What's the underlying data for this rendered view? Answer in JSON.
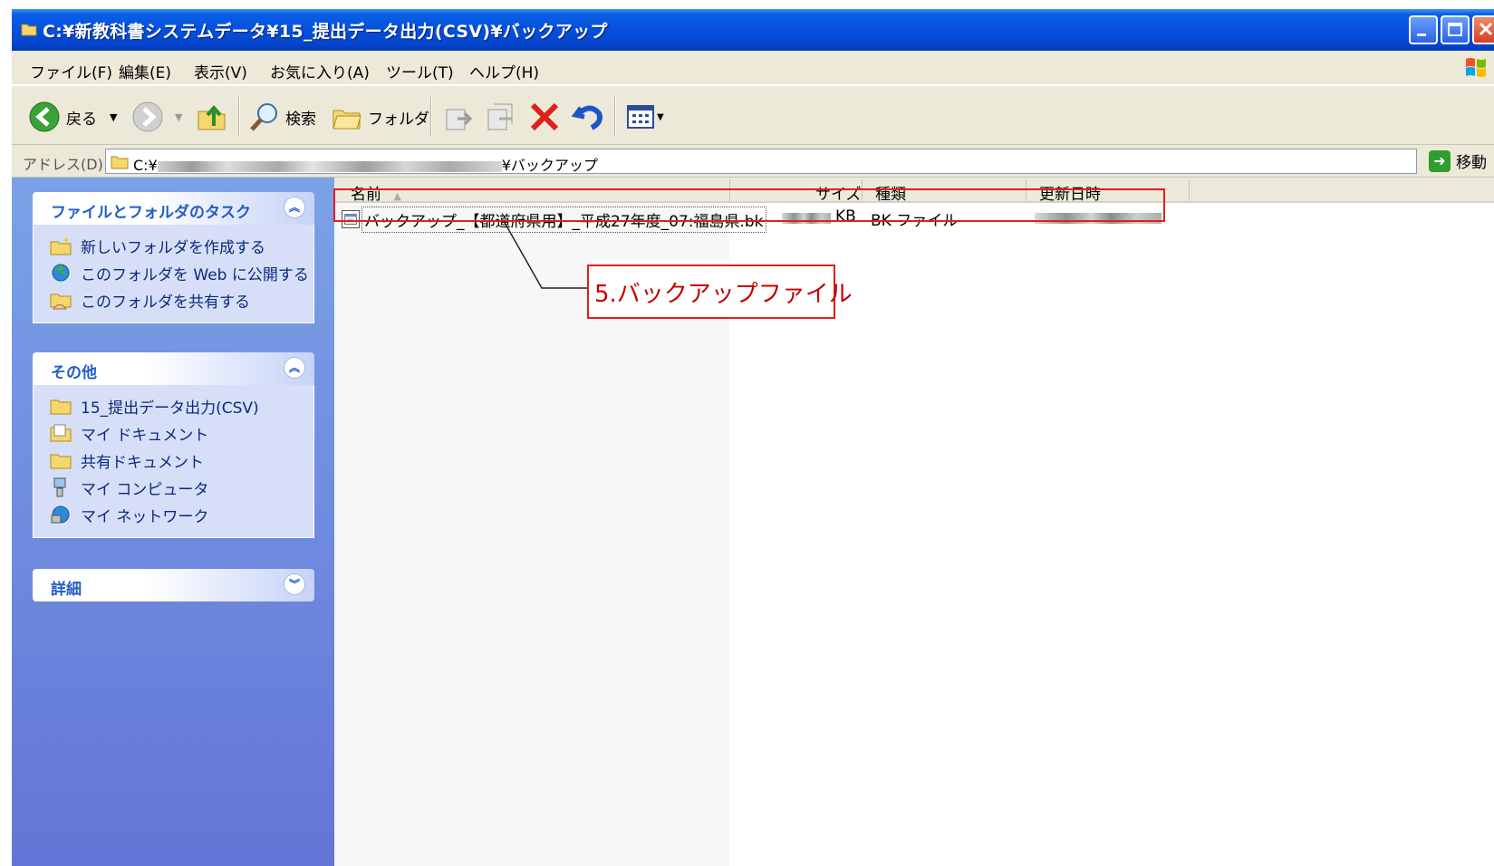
{
  "window": {
    "title": "C:¥新教科書システムデータ¥15_提出データ出力(CSV)¥バックアップ"
  },
  "menu": {
    "items": [
      "ファイル(F)",
      "編集(E)",
      "表示(V)",
      "お気に入り(A)",
      "ツール(T)",
      "ヘルプ(H)"
    ]
  },
  "toolbar": {
    "back_label": "戻る",
    "search_label": "検索",
    "folders_label": "フォルダ"
  },
  "address": {
    "label": "アドレス(D)",
    "prefix": "C:¥",
    "suffix": "¥バックアップ",
    "go_label": "移動"
  },
  "taskpane": {
    "file_tasks": {
      "title": "ファイルとフォルダのタスク",
      "items": [
        "新しいフォルダを作成する",
        "このフォルダを Web に公開する",
        "このフォルダを共有する"
      ]
    },
    "other_places": {
      "title": "その他",
      "items": [
        "15_提出データ出力(CSV)",
        "マイ ドキュメント",
        "共有ドキュメント",
        "マイ コンピュータ",
        "マイ ネットワーク"
      ]
    },
    "details": {
      "title": "詳細"
    }
  },
  "filelist": {
    "columns": [
      "名前",
      "サイズ",
      "種類",
      "更新日時"
    ],
    "rows": [
      {
        "name": "バックアップ_【都道府県用】_平成27年度_07:福島県.bk",
        "size_unit": "KB",
        "type": "BK ファイル"
      }
    ]
  },
  "annotation": {
    "label": "5.バックアップファイル",
    "color": "#e0201c"
  },
  "colors": {
    "title_bar": "#0550dc",
    "task_pane": "#6375d6",
    "panel_heading": "#215dc6"
  }
}
